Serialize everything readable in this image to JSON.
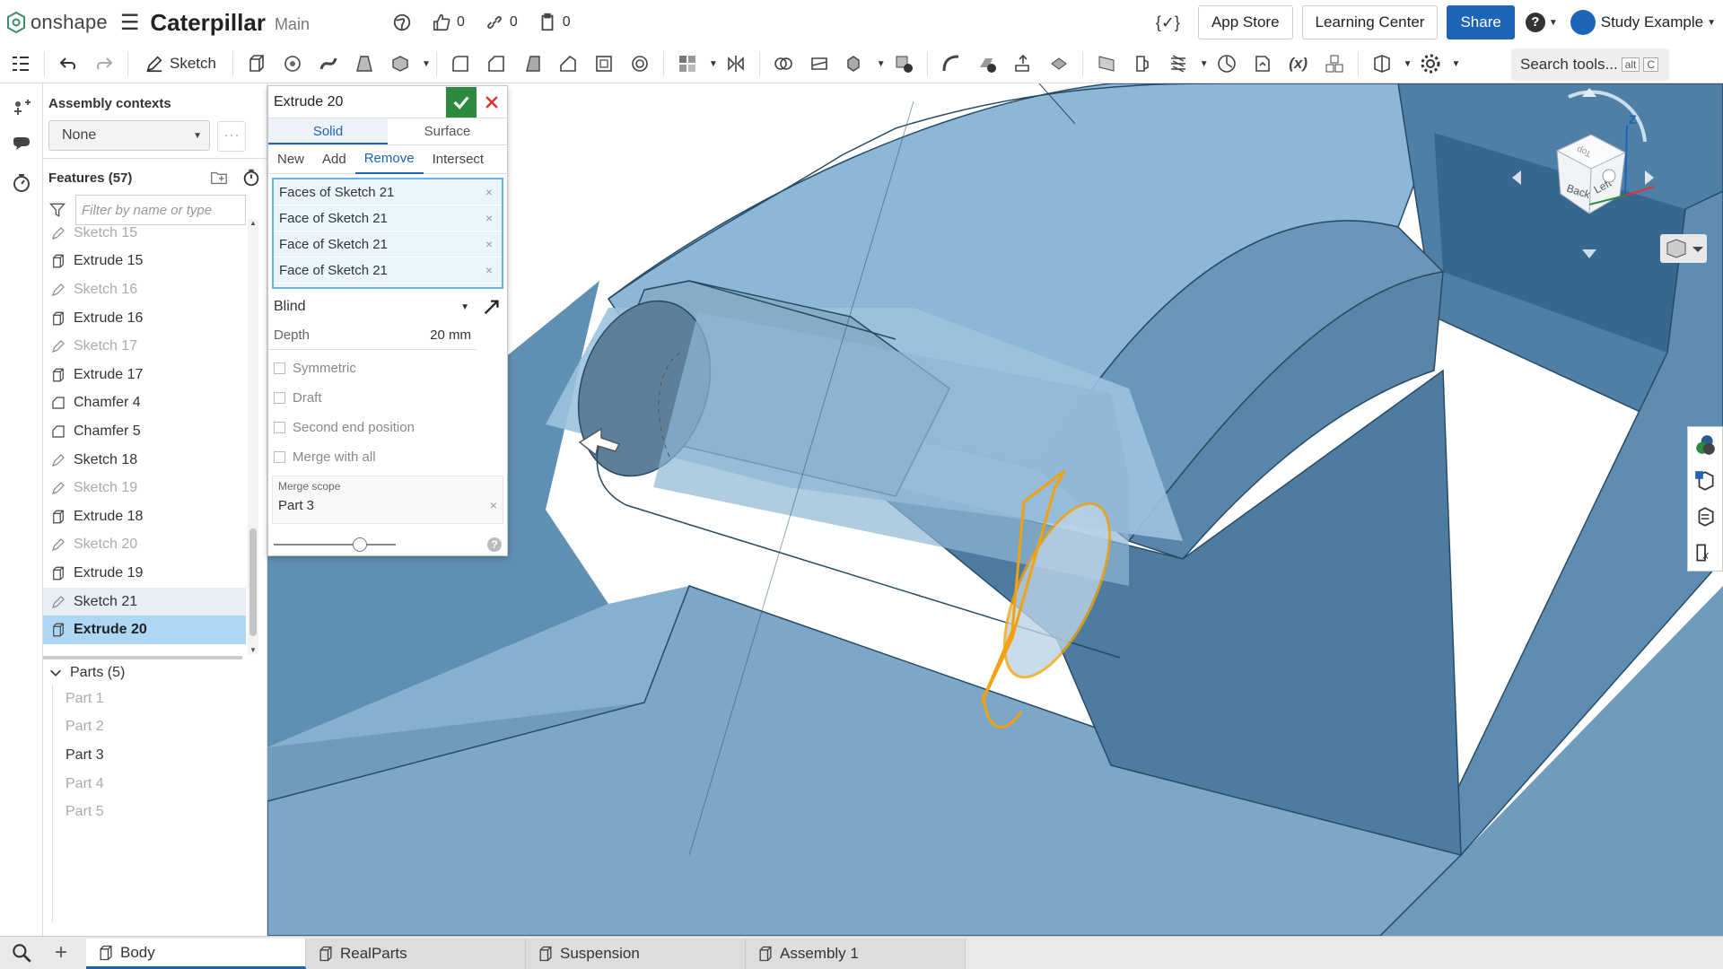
{
  "app": {
    "brand": "onshape",
    "document_title": "Caterpillar",
    "branch": "Main"
  },
  "counts": {
    "likes": "0",
    "links": "0",
    "copies": "0"
  },
  "top_buttons": {
    "fx": "{✓}",
    "app_store": "App Store",
    "learning_center": "Learning Center",
    "share": "Share",
    "help": "?",
    "user": "Study Example"
  },
  "toolbar": {
    "sketch": "Sketch",
    "search_placeholder": "Search tools...",
    "shortcut_alt": "alt",
    "shortcut_key": "C",
    "fx_label": "(x)"
  },
  "assembly": {
    "header": "Assembly contexts",
    "selected": "None",
    "more": "···"
  },
  "features": {
    "header": "Features (57)",
    "filter_placeholder": "Filter by name or type",
    "items": [
      {
        "label": "Sketch 15",
        "type": "sketch",
        "state": "dim"
      },
      {
        "label": "Extrude 15",
        "type": "extrude",
        "state": "normal"
      },
      {
        "label": "Sketch 16",
        "type": "sketch",
        "state": "dim"
      },
      {
        "label": "Extrude 16",
        "type": "extrude",
        "state": "normal"
      },
      {
        "label": "Sketch 17",
        "type": "sketch",
        "state": "dim"
      },
      {
        "label": "Extrude 17",
        "type": "extrude",
        "state": "normal"
      },
      {
        "label": "Chamfer 4",
        "type": "chamfer",
        "state": "normal"
      },
      {
        "label": "Chamfer 5",
        "type": "chamfer",
        "state": "normal"
      },
      {
        "label": "Sketch 18",
        "type": "sketch",
        "state": "normal"
      },
      {
        "label": "Sketch 19",
        "type": "sketch",
        "state": "dim"
      },
      {
        "label": "Extrude 18",
        "type": "extrude",
        "state": "normal"
      },
      {
        "label": "Sketch 20",
        "type": "sketch",
        "state": "dim"
      },
      {
        "label": "Extrude 19",
        "type": "extrude",
        "state": "normal"
      },
      {
        "label": "Sketch 21",
        "type": "sketch",
        "state": "highlight"
      },
      {
        "label": "Extrude 20",
        "type": "extrude",
        "state": "selected"
      }
    ]
  },
  "parts": {
    "header": "Parts (5)",
    "items": [
      {
        "label": "Part 1",
        "active": false
      },
      {
        "label": "Part 2",
        "active": false
      },
      {
        "label": "Part 3",
        "active": true
      },
      {
        "label": "Part 4",
        "active": false
      },
      {
        "label": "Part 5",
        "active": false
      }
    ]
  },
  "dialog": {
    "title": "Extrude 20",
    "body_tabs": [
      "Solid",
      "Surface"
    ],
    "active_body_tab": "Solid",
    "op_tabs": [
      "New",
      "Add",
      "Remove",
      "Intersect"
    ],
    "active_op_tab": "Remove",
    "selections": [
      "Faces of Sketch 21",
      "Face of Sketch 21",
      "Face of Sketch 21",
      "Face of Sketch 21"
    ],
    "end_type": "Blind",
    "depth_label": "Depth",
    "depth_value": "20 mm",
    "options": [
      "Symmetric",
      "Draft",
      "Second end position",
      "Merge with all"
    ],
    "merge_scope_label": "Merge scope",
    "merge_scope_value": "Part 3",
    "help": "?"
  },
  "viewcube": {
    "front": "Back",
    "side": "Left",
    "top": "Top",
    "axis_z": "Z"
  },
  "bottom_tabs": [
    {
      "label": "Body",
      "active": true
    },
    {
      "label": "RealParts",
      "active": false
    },
    {
      "label": "Suspension",
      "active": false
    },
    {
      "label": "Assembly 1",
      "active": false
    }
  ],
  "colors": {
    "accent": "#1d64b8",
    "model": "#7ea7c6",
    "selection": "#f2a20c",
    "confirm": "#2b8a3e",
    "selected_row": "#aed6f5"
  }
}
